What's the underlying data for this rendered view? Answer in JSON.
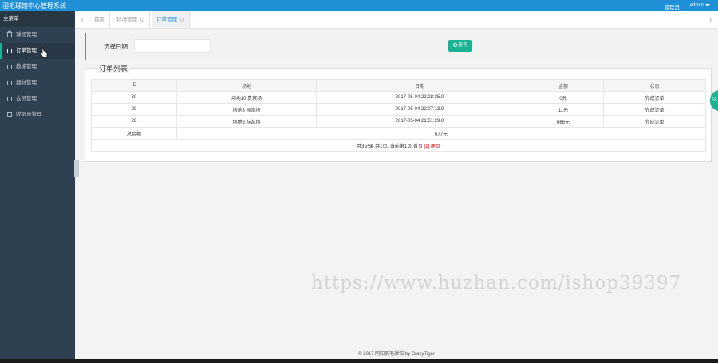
{
  "app": {
    "title": "羽毛球馆中心管理系统",
    "role": "管理员",
    "user": "admin"
  },
  "sidebar": {
    "title": "主菜单",
    "items": [
      {
        "label": "球场管理",
        "icon": "home-icon"
      },
      {
        "label": "订单管理",
        "icon": "document-icon",
        "active": true
      },
      {
        "label": "教练管理",
        "icon": "document-icon"
      },
      {
        "label": "器材管理",
        "icon": "document-icon"
      },
      {
        "label": "会员管理",
        "icon": "document-icon"
      },
      {
        "label": "收银员管理",
        "icon": "document-icon"
      }
    ]
  },
  "tabs": [
    {
      "label": "首页"
    },
    {
      "label": "球场管理"
    },
    {
      "label": "订单管理",
      "active": true
    }
  ],
  "nav": {
    "left": "«",
    "right": "»"
  },
  "search": {
    "label": "选择日期",
    "date_value": "",
    "button_label": "查询"
  },
  "orders": {
    "legend": "订单列表",
    "headers": [
      "ID",
      "场地",
      "日期",
      "金额",
      "状态"
    ],
    "rows": [
      [
        "30",
        "场地10 贵宾场",
        "2017-05-04 22:28:35.0",
        "0元",
        "完成订单"
      ],
      [
        "29",
        "场地3 标准场",
        "2017-05-04 22:07:13.0",
        "11元",
        "完成订单"
      ],
      [
        "28",
        "场地3 标准场",
        "2017-05-04 21:51:29.0",
        "666元",
        "完成订单"
      ]
    ],
    "total_label": "总金额",
    "total_value": "677元",
    "pagination_text": "共3记录,共1页, 当前第1页 首页",
    "pagination_current": "[1]",
    "pagination_last": "尾页"
  },
  "help_badge": "55",
  "watermark": "https://www.huzhan.com/ishop39397",
  "footer": "© 2017 阿阳羽毛球馆 by CrazyTiger",
  "colors": {
    "topbar": "#1f8fd6",
    "sidebar": "#2f4050",
    "accent": "#1ab394"
  }
}
